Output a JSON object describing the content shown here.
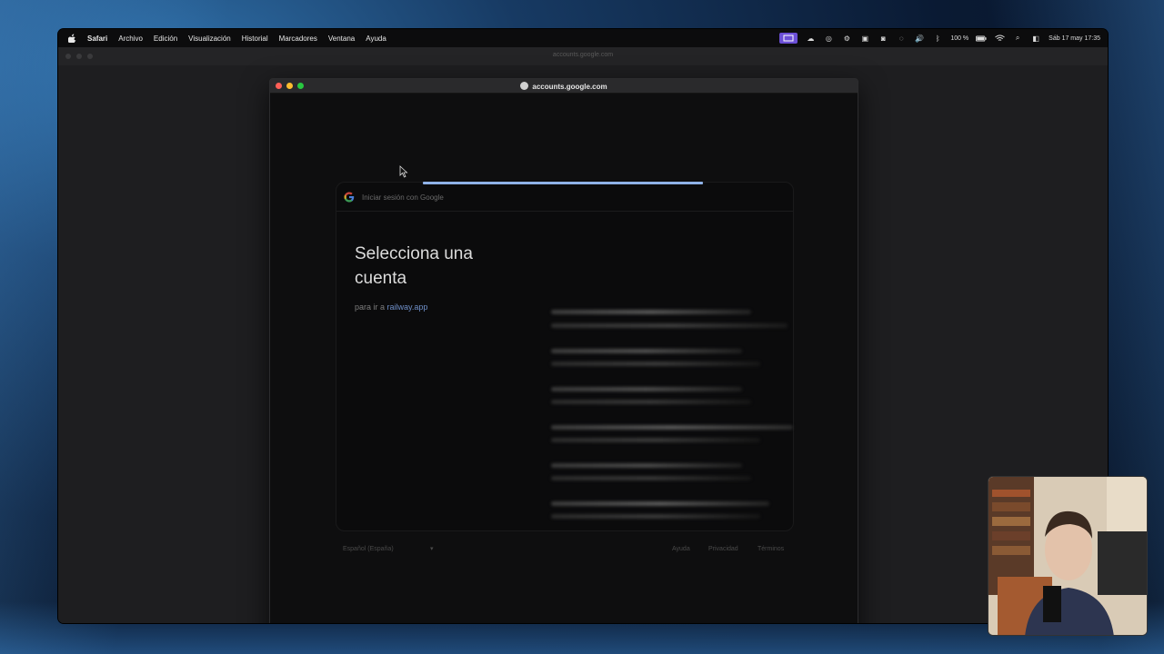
{
  "menubar": {
    "items": [
      "Safari",
      "Archivo",
      "Edición",
      "Visualización",
      "Historial",
      "Marcadores",
      "Ventana",
      "Ayuda"
    ],
    "battery": "100 %",
    "clock": "Sáb 17 may 17:35"
  },
  "background_window": {
    "url": "accounts.google.com"
  },
  "popup": {
    "url": "accounts.google.com",
    "header": "Iniciar sesión con Google",
    "heading": "Selecciona una cuenta",
    "subtitle_prefix": "para ir a ",
    "subtitle_link": "railway.app",
    "footer": {
      "language": "Español (España)",
      "help": "Ayuda",
      "privacy": "Privacidad",
      "terms": "Términos"
    }
  },
  "colors": {
    "progress": "#8fb2e8",
    "link": "#6f8fc8",
    "accent_menu": "#6b4fd6"
  }
}
